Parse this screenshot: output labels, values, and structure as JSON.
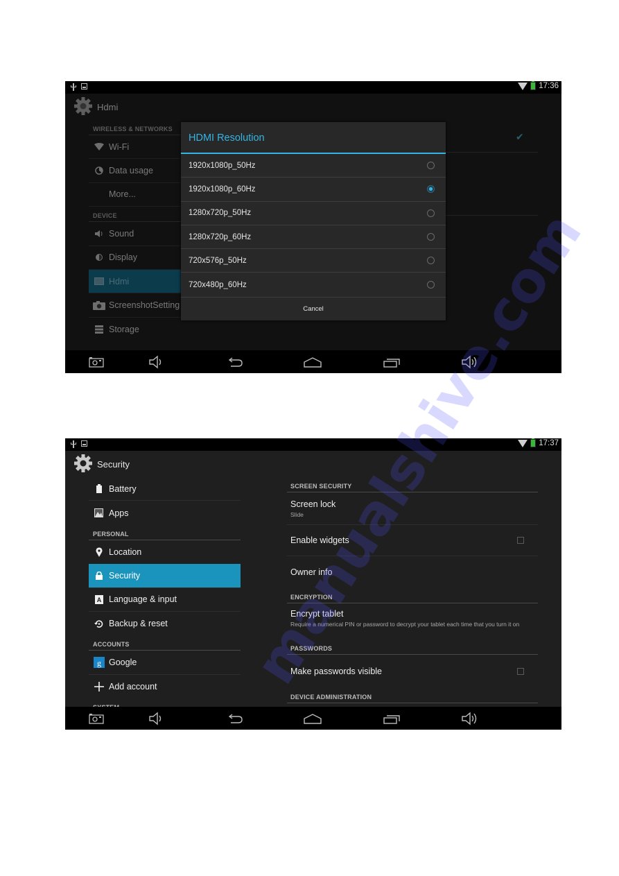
{
  "screenshot1": {
    "status": {
      "time": "17:36"
    },
    "actionbar": {
      "title": "Hdmi"
    },
    "sidebar": {
      "sections": [
        {
          "header": "WIRELESS & NETWORKS",
          "items": [
            {
              "label": "Wi-Fi",
              "icon": "wifi-icon"
            },
            {
              "label": "Data usage",
              "icon": "data-usage-icon"
            },
            {
              "label": "More...",
              "icon": ""
            }
          ]
        },
        {
          "header": "DEVICE",
          "items": [
            {
              "label": "Sound",
              "icon": "sound-icon"
            },
            {
              "label": "Display",
              "icon": "display-icon"
            },
            {
              "label": "Hdmi",
              "icon": "hdmi-icon",
              "active": true
            },
            {
              "label": "ScreenshotSetting",
              "icon": "camera-icon"
            },
            {
              "label": "Storage",
              "icon": "storage-icon"
            }
          ]
        }
      ]
    },
    "background_checkbox_checked": true,
    "dialog": {
      "title": "HDMI Resolution",
      "options": [
        {
          "label": "1920x1080p_50Hz",
          "selected": false
        },
        {
          "label": "1920x1080p_60Hz",
          "selected": true
        },
        {
          "label": "1280x720p_50Hz",
          "selected": false
        },
        {
          "label": "1280x720p_60Hz",
          "selected": false
        },
        {
          "label": "720x576p_50Hz",
          "selected": false
        },
        {
          "label": "720x480p_60Hz",
          "selected": false
        }
      ],
      "cancel_label": "Cancel"
    }
  },
  "screenshot2": {
    "status": {
      "time": "17:37"
    },
    "actionbar": {
      "title": "Security"
    },
    "sidebar": {
      "items_top": [
        {
          "label": "Battery",
          "icon": "battery-icon"
        },
        {
          "label": "Apps",
          "icon": "apps-icon"
        }
      ],
      "personal_header": "PERSONAL",
      "personal_items": [
        {
          "label": "Location",
          "icon": "location-icon"
        },
        {
          "label": "Security",
          "icon": "lock-icon",
          "active": true
        },
        {
          "label": "Language & input",
          "icon": "language-icon"
        },
        {
          "label": "Backup & reset",
          "icon": "backup-icon"
        }
      ],
      "accounts_header": "ACCOUNTS",
      "accounts_items": [
        {
          "label": "Google",
          "icon": "google-icon"
        },
        {
          "label": "Add account",
          "icon": "plus-icon"
        }
      ],
      "system_header": "SYSTEM"
    },
    "detail": {
      "screen_security_header": "SCREEN SECURITY",
      "screen_lock": {
        "title": "Screen lock",
        "summary": "Slide"
      },
      "enable_widgets": {
        "title": "Enable widgets",
        "checked": false
      },
      "owner_info": {
        "title": "Owner info"
      },
      "encryption_header": "ENCRYPTION",
      "encrypt_tablet": {
        "title": "Encrypt tablet",
        "summary": "Require a numerical PIN or password to decrypt your tablet each time that you turn it on"
      },
      "passwords_header": "PASSWORDS",
      "make_passwords_visible": {
        "title": "Make passwords visible",
        "checked": false
      },
      "device_admin_header": "DEVICE ADMINISTRATION"
    }
  },
  "navbar": {
    "buttons": [
      "screenshot-icon",
      "volume-down-icon",
      "back-icon",
      "home-icon",
      "recent-apps-icon",
      "volume-up-icon"
    ]
  },
  "watermark": "manualshive.com",
  "colors": {
    "accent": "#33b5e5",
    "active_item": "#1b94bd"
  }
}
